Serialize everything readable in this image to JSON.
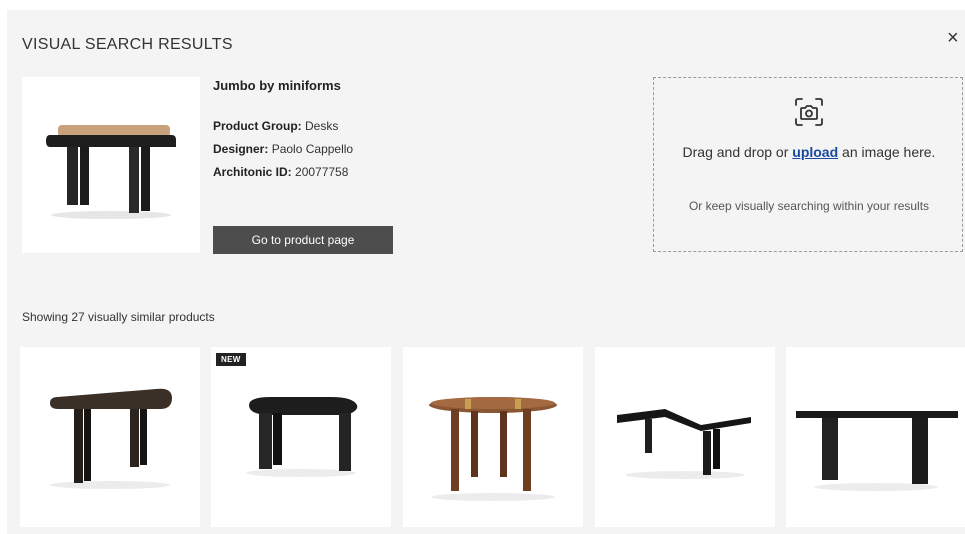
{
  "header": {
    "title": "VISUAL SEARCH RESULTS",
    "close_symbol": "×"
  },
  "product": {
    "name": "Jumbo by miniforms",
    "fields": [
      {
        "label": "Product Group:",
        "value": "Desks"
      },
      {
        "label": "Designer:",
        "value": "Paolo Cappello"
      },
      {
        "label": "Architonic ID:",
        "value": "20077758"
      }
    ],
    "cta_label": "Go to product page",
    "image_icon": "black-console-desk-with-wood-tray"
  },
  "upload": {
    "icon": "camera-icon",
    "text_before": "Drag and drop or",
    "link_label": "upload",
    "text_after": "an image here.",
    "sub_text": "Or keep visually searching within your results"
  },
  "results": {
    "summary": "Showing 27 visually similar products",
    "items": [
      {
        "badge": "",
        "image": "dark-kidney-console-table"
      },
      {
        "badge": "NEW",
        "image": "black-pebble-side-table"
      },
      {
        "badge": "",
        "image": "round-walnut-dining-table"
      },
      {
        "badge": "",
        "image": "black-angular-desk"
      },
      {
        "badge": "",
        "image": "black-long-console-table"
      }
    ]
  },
  "colors": {
    "panel_bg": "#f4f4f4",
    "button_bg": "#4d4d4d",
    "link": "#1a4aa0",
    "furniture_dark": "#1e1e1e",
    "wood": "#7a4a2b"
  }
}
